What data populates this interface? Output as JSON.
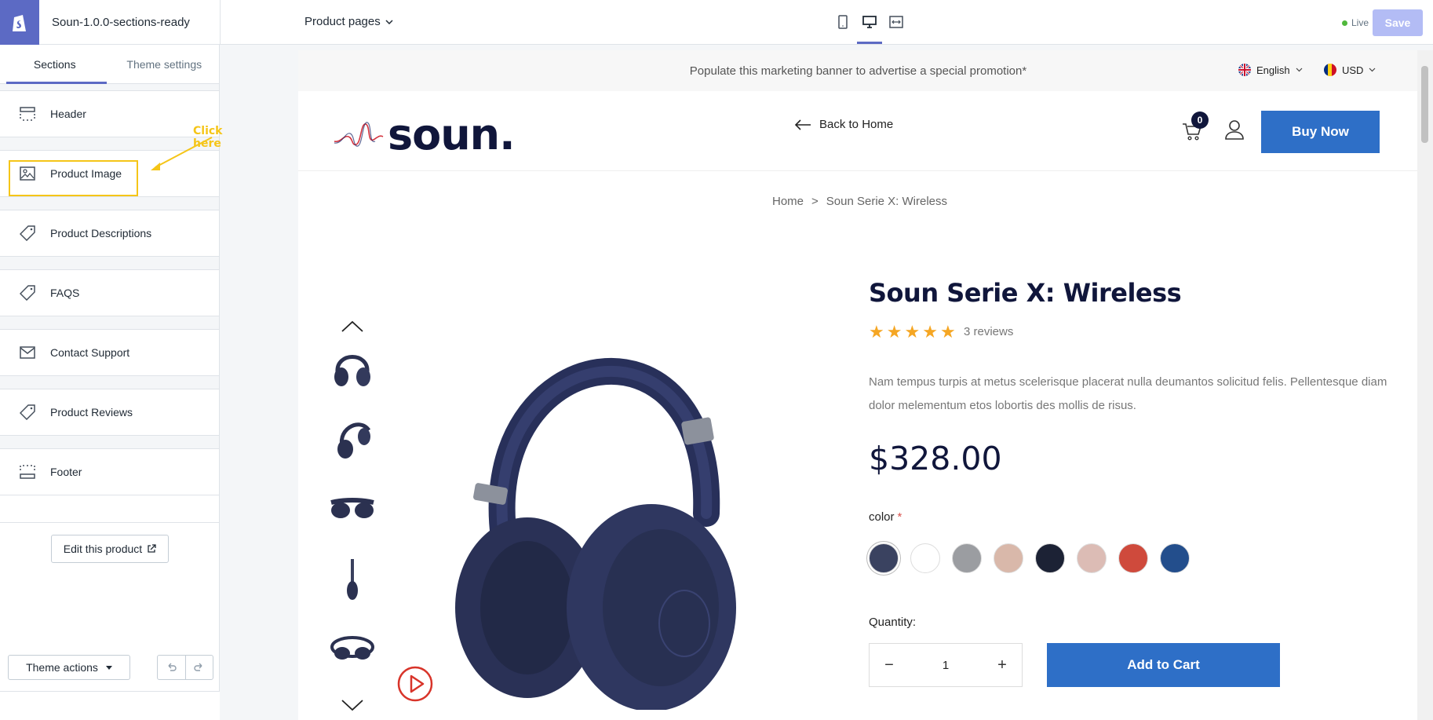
{
  "topbar": {
    "theme_name": "Soun-1.0.0-sections-ready",
    "page_selector": "Product pages",
    "devices": [
      "mobile-icon",
      "desktop-icon",
      "full-width-icon"
    ],
    "live_label": "Live",
    "save_label": "Save"
  },
  "sidebar": {
    "tabs": [
      {
        "label": "Sections",
        "active": true
      },
      {
        "label": "Theme settings",
        "active": false
      }
    ],
    "sections": [
      {
        "label": "Header",
        "icon": "header-layout-icon"
      },
      {
        "label": "Product Image",
        "icon": "image-icon"
      },
      {
        "label": "Product Descriptions",
        "icon": "tag-icon"
      },
      {
        "label": "FAQS",
        "icon": "tag-icon"
      },
      {
        "label": "Contact Support",
        "icon": "envelope-icon"
      },
      {
        "label": "Product Reviews",
        "icon": "tag-icon"
      },
      {
        "label": "Footer",
        "icon": "footer-layout-icon"
      }
    ],
    "callout": "Click here",
    "edit_product": "Edit this product",
    "theme_actions": "Theme actions"
  },
  "store": {
    "promo": "Populate this marketing banner to advertise a special promotion*",
    "language": "English",
    "currency": "USD",
    "brand": "soun.",
    "back_home": "Back to Home",
    "cart_count": "0",
    "buy_now": "Buy Now",
    "breadcrumb": {
      "home": "Home",
      "separator": ">",
      "current": "Soun Serie X: Wireless"
    },
    "product": {
      "title": "Soun Serie X: Wireless",
      "rating": 5,
      "reviews": "3 reviews",
      "description": "Nam tempus turpis at metus scelerisque placerat nulla deumantos solicitud felis. Pellentesque diam dolor melementum etos lobortis des mollis de risus.",
      "price": "$328.00",
      "color_label": "color",
      "required_mark": "*",
      "colors": [
        "#3a4260",
        "#ffffff",
        "#9b9da1",
        "#d9b8aa",
        "#1c2235",
        "#dcbcb5",
        "#cf4a3c",
        "#234e8c"
      ],
      "quantity_label": "Quantity:",
      "quantity": "1",
      "add_to_cart": "Add to Cart"
    }
  },
  "colors": {
    "accent": "#5c6ac4",
    "brand_navy": "#10163b",
    "button_blue": "#2e6fc7",
    "callout_yellow": "#f5c518",
    "star": "#f5a623"
  }
}
